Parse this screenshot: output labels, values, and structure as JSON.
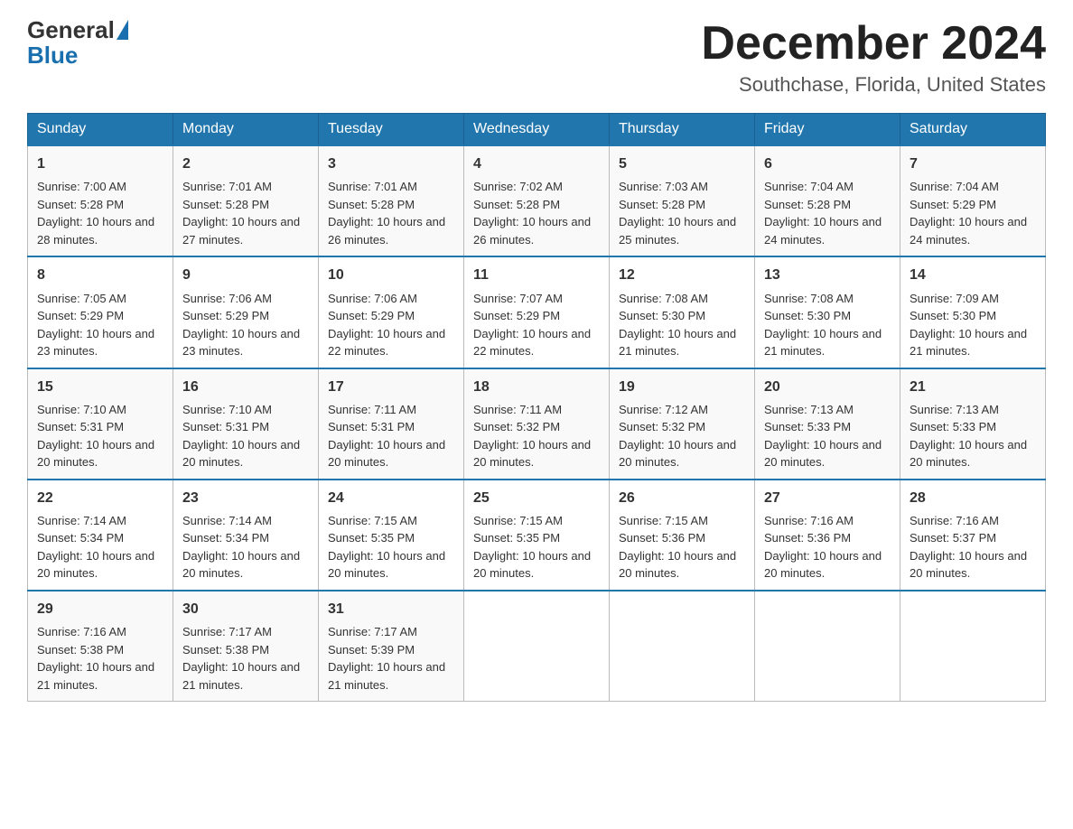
{
  "header": {
    "logo_general": "General",
    "logo_blue": "Blue",
    "month_title": "December 2024",
    "location": "Southchase, Florida, United States"
  },
  "days_of_week": [
    "Sunday",
    "Monday",
    "Tuesday",
    "Wednesday",
    "Thursday",
    "Friday",
    "Saturday"
  ],
  "weeks": [
    [
      {
        "day": "1",
        "sunrise": "7:00 AM",
        "sunset": "5:28 PM",
        "daylight": "10 hours and 28 minutes."
      },
      {
        "day": "2",
        "sunrise": "7:01 AM",
        "sunset": "5:28 PM",
        "daylight": "10 hours and 27 minutes."
      },
      {
        "day": "3",
        "sunrise": "7:01 AM",
        "sunset": "5:28 PM",
        "daylight": "10 hours and 26 minutes."
      },
      {
        "day": "4",
        "sunrise": "7:02 AM",
        "sunset": "5:28 PM",
        "daylight": "10 hours and 26 minutes."
      },
      {
        "day": "5",
        "sunrise": "7:03 AM",
        "sunset": "5:28 PM",
        "daylight": "10 hours and 25 minutes."
      },
      {
        "day": "6",
        "sunrise": "7:04 AM",
        "sunset": "5:28 PM",
        "daylight": "10 hours and 24 minutes."
      },
      {
        "day": "7",
        "sunrise": "7:04 AM",
        "sunset": "5:29 PM",
        "daylight": "10 hours and 24 minutes."
      }
    ],
    [
      {
        "day": "8",
        "sunrise": "7:05 AM",
        "sunset": "5:29 PM",
        "daylight": "10 hours and 23 minutes."
      },
      {
        "day": "9",
        "sunrise": "7:06 AM",
        "sunset": "5:29 PM",
        "daylight": "10 hours and 23 minutes."
      },
      {
        "day": "10",
        "sunrise": "7:06 AM",
        "sunset": "5:29 PM",
        "daylight": "10 hours and 22 minutes."
      },
      {
        "day": "11",
        "sunrise": "7:07 AM",
        "sunset": "5:29 PM",
        "daylight": "10 hours and 22 minutes."
      },
      {
        "day": "12",
        "sunrise": "7:08 AM",
        "sunset": "5:30 PM",
        "daylight": "10 hours and 21 minutes."
      },
      {
        "day": "13",
        "sunrise": "7:08 AM",
        "sunset": "5:30 PM",
        "daylight": "10 hours and 21 minutes."
      },
      {
        "day": "14",
        "sunrise": "7:09 AM",
        "sunset": "5:30 PM",
        "daylight": "10 hours and 21 minutes."
      }
    ],
    [
      {
        "day": "15",
        "sunrise": "7:10 AM",
        "sunset": "5:31 PM",
        "daylight": "10 hours and 20 minutes."
      },
      {
        "day": "16",
        "sunrise": "7:10 AM",
        "sunset": "5:31 PM",
        "daylight": "10 hours and 20 minutes."
      },
      {
        "day": "17",
        "sunrise": "7:11 AM",
        "sunset": "5:31 PM",
        "daylight": "10 hours and 20 minutes."
      },
      {
        "day": "18",
        "sunrise": "7:11 AM",
        "sunset": "5:32 PM",
        "daylight": "10 hours and 20 minutes."
      },
      {
        "day": "19",
        "sunrise": "7:12 AM",
        "sunset": "5:32 PM",
        "daylight": "10 hours and 20 minutes."
      },
      {
        "day": "20",
        "sunrise": "7:13 AM",
        "sunset": "5:33 PM",
        "daylight": "10 hours and 20 minutes."
      },
      {
        "day": "21",
        "sunrise": "7:13 AM",
        "sunset": "5:33 PM",
        "daylight": "10 hours and 20 minutes."
      }
    ],
    [
      {
        "day": "22",
        "sunrise": "7:14 AM",
        "sunset": "5:34 PM",
        "daylight": "10 hours and 20 minutes."
      },
      {
        "day": "23",
        "sunrise": "7:14 AM",
        "sunset": "5:34 PM",
        "daylight": "10 hours and 20 minutes."
      },
      {
        "day": "24",
        "sunrise": "7:15 AM",
        "sunset": "5:35 PM",
        "daylight": "10 hours and 20 minutes."
      },
      {
        "day": "25",
        "sunrise": "7:15 AM",
        "sunset": "5:35 PM",
        "daylight": "10 hours and 20 minutes."
      },
      {
        "day": "26",
        "sunrise": "7:15 AM",
        "sunset": "5:36 PM",
        "daylight": "10 hours and 20 minutes."
      },
      {
        "day": "27",
        "sunrise": "7:16 AM",
        "sunset": "5:36 PM",
        "daylight": "10 hours and 20 minutes."
      },
      {
        "day": "28",
        "sunrise": "7:16 AM",
        "sunset": "5:37 PM",
        "daylight": "10 hours and 20 minutes."
      }
    ],
    [
      {
        "day": "29",
        "sunrise": "7:16 AM",
        "sunset": "5:38 PM",
        "daylight": "10 hours and 21 minutes."
      },
      {
        "day": "30",
        "sunrise": "7:17 AM",
        "sunset": "5:38 PM",
        "daylight": "10 hours and 21 minutes."
      },
      {
        "day": "31",
        "sunrise": "7:17 AM",
        "sunset": "5:39 PM",
        "daylight": "10 hours and 21 minutes."
      },
      null,
      null,
      null,
      null
    ]
  ]
}
